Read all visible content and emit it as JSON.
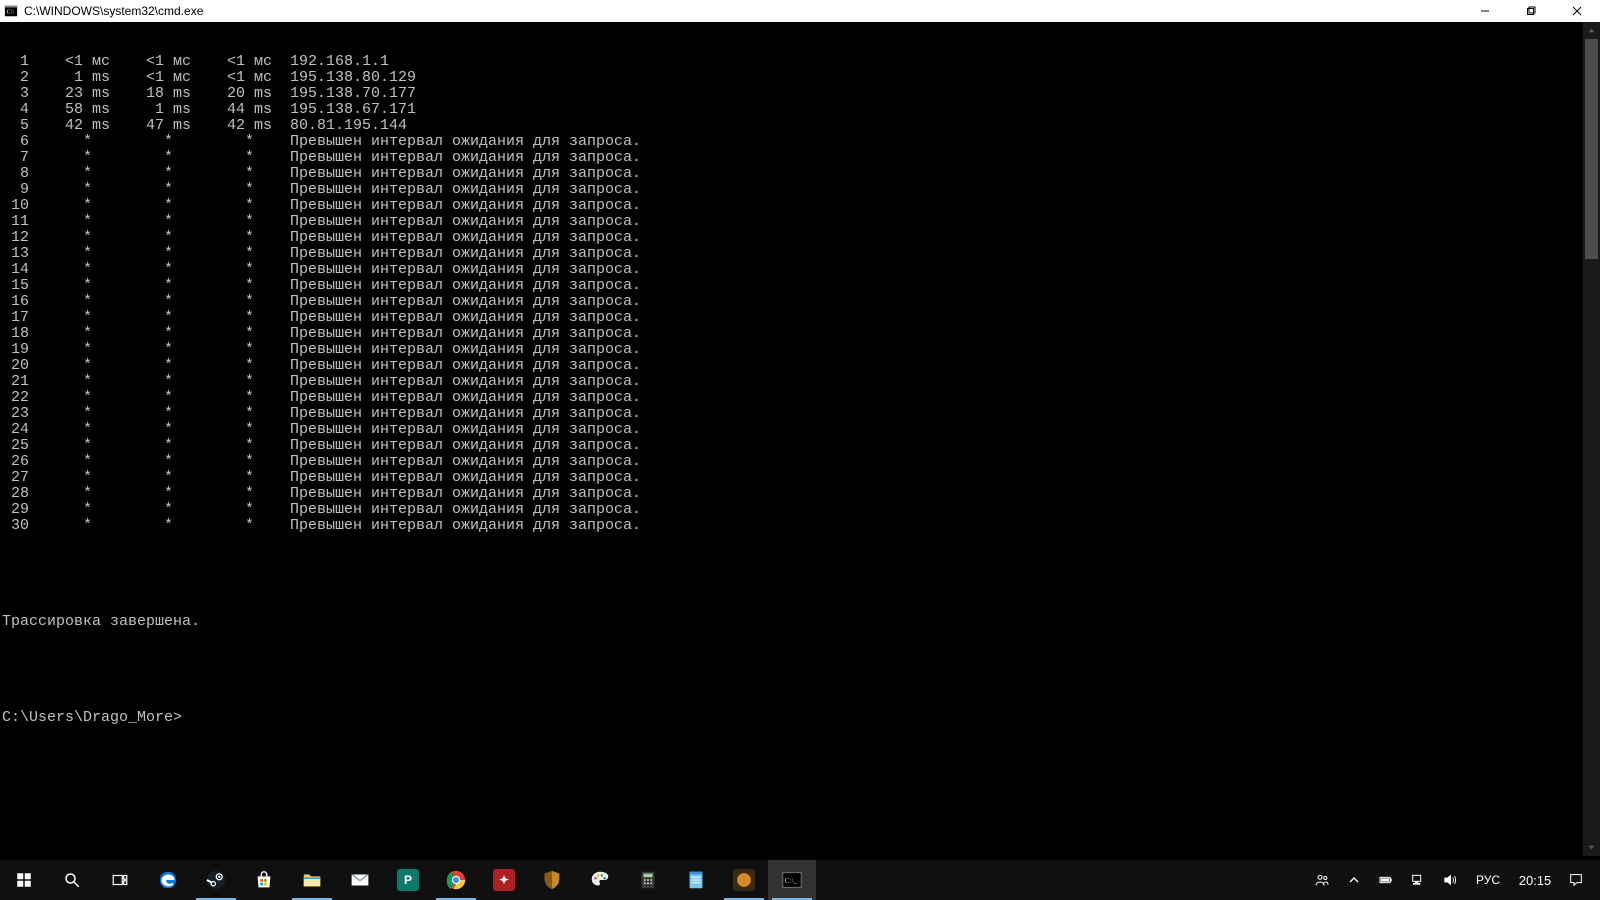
{
  "window": {
    "title": "C:\\WINDOWS\\system32\\cmd.exe"
  },
  "tracert": {
    "hops": [
      {
        "n": "1",
        "t1": "<1 мс",
        "t2": "<1 мс",
        "t3": "<1 мс",
        "host": "192.168.1.1"
      },
      {
        "n": "2",
        "t1": "1 ms",
        "t2": "<1 мс",
        "t3": "<1 мс",
        "host": "195.138.80.129"
      },
      {
        "n": "3",
        "t1": "23 ms",
        "t2": "18 ms",
        "t3": "20 ms",
        "host": "195.138.70.177"
      },
      {
        "n": "4",
        "t1": "58 ms",
        "t2": "1 ms",
        "t3": "44 ms",
        "host": "195.138.67.171"
      },
      {
        "n": "5",
        "t1": "42 ms",
        "t2": "47 ms",
        "t3": "42 ms",
        "host": "80.81.195.144"
      },
      {
        "n": "6",
        "t1": "*",
        "t2": "*",
        "t3": "*",
        "host": "Превышен интервал ожидания для запроса."
      },
      {
        "n": "7",
        "t1": "*",
        "t2": "*",
        "t3": "*",
        "host": "Превышен интервал ожидания для запроса."
      },
      {
        "n": "8",
        "t1": "*",
        "t2": "*",
        "t3": "*",
        "host": "Превышен интервал ожидания для запроса."
      },
      {
        "n": "9",
        "t1": "*",
        "t2": "*",
        "t3": "*",
        "host": "Превышен интервал ожидания для запроса."
      },
      {
        "n": "10",
        "t1": "*",
        "t2": "*",
        "t3": "*",
        "host": "Превышен интервал ожидания для запроса."
      },
      {
        "n": "11",
        "t1": "*",
        "t2": "*",
        "t3": "*",
        "host": "Превышен интервал ожидания для запроса."
      },
      {
        "n": "12",
        "t1": "*",
        "t2": "*",
        "t3": "*",
        "host": "Превышен интервал ожидания для запроса."
      },
      {
        "n": "13",
        "t1": "*",
        "t2": "*",
        "t3": "*",
        "host": "Превышен интервал ожидания для запроса."
      },
      {
        "n": "14",
        "t1": "*",
        "t2": "*",
        "t3": "*",
        "host": "Превышен интервал ожидания для запроса."
      },
      {
        "n": "15",
        "t1": "*",
        "t2": "*",
        "t3": "*",
        "host": "Превышен интервал ожидания для запроса."
      },
      {
        "n": "16",
        "t1": "*",
        "t2": "*",
        "t3": "*",
        "host": "Превышен интервал ожидания для запроса."
      },
      {
        "n": "17",
        "t1": "*",
        "t2": "*",
        "t3": "*",
        "host": "Превышен интервал ожидания для запроса."
      },
      {
        "n": "18",
        "t1": "*",
        "t2": "*",
        "t3": "*",
        "host": "Превышен интервал ожидания для запроса."
      },
      {
        "n": "19",
        "t1": "*",
        "t2": "*",
        "t3": "*",
        "host": "Превышен интервал ожидания для запроса."
      },
      {
        "n": "20",
        "t1": "*",
        "t2": "*",
        "t3": "*",
        "host": "Превышен интервал ожидания для запроса."
      },
      {
        "n": "21",
        "t1": "*",
        "t2": "*",
        "t3": "*",
        "host": "Превышен интервал ожидания для запроса."
      },
      {
        "n": "22",
        "t1": "*",
        "t2": "*",
        "t3": "*",
        "host": "Превышен интервал ожидания для запроса."
      },
      {
        "n": "23",
        "t1": "*",
        "t2": "*",
        "t3": "*",
        "host": "Превышен интервал ожидания для запроса."
      },
      {
        "n": "24",
        "t1": "*",
        "t2": "*",
        "t3": "*",
        "host": "Превышен интервал ожидания для запроса."
      },
      {
        "n": "25",
        "t1": "*",
        "t2": "*",
        "t3": "*",
        "host": "Превышен интервал ожидания для запроса."
      },
      {
        "n": "26",
        "t1": "*",
        "t2": "*",
        "t3": "*",
        "host": "Превышен интервал ожидания для запроса."
      },
      {
        "n": "27",
        "t1": "*",
        "t2": "*",
        "t3": "*",
        "host": "Превышен интервал ожидания для запроса."
      },
      {
        "n": "28",
        "t1": "*",
        "t2": "*",
        "t3": "*",
        "host": "Превышен интервал ожидания для запроса."
      },
      {
        "n": "29",
        "t1": "*",
        "t2": "*",
        "t3": "*",
        "host": "Превышен интервал ожидания для запроса."
      },
      {
        "n": "30",
        "t1": "*",
        "t2": "*",
        "t3": "*",
        "host": "Превышен интервал ожидания для запроса."
      }
    ],
    "complete": "Трассировка завершена.",
    "prompt": "C:\\Users\\Drago_More>"
  },
  "taskbar": {
    "apps": [
      {
        "id": "start",
        "type": "system",
        "icon": "windows"
      },
      {
        "id": "search",
        "type": "system",
        "icon": "search"
      },
      {
        "id": "taskview",
        "type": "system",
        "icon": "taskview"
      },
      {
        "id": "edge",
        "type": "app",
        "icon": "edge",
        "running": false
      },
      {
        "id": "steam",
        "type": "app",
        "icon": "steam",
        "running": true
      },
      {
        "id": "store",
        "type": "app",
        "icon": "store",
        "running": false
      },
      {
        "id": "explorer",
        "type": "app",
        "icon": "explorer",
        "running": true
      },
      {
        "id": "mail",
        "type": "app",
        "icon": "mail",
        "running": false
      },
      {
        "id": "publisher",
        "type": "app",
        "icon": "publisher",
        "running": false
      },
      {
        "id": "chrome",
        "type": "app",
        "icon": "chrome",
        "running": true
      },
      {
        "id": "app-x",
        "type": "app",
        "icon": "app-red",
        "running": false
      },
      {
        "id": "app-shield",
        "type": "app",
        "icon": "shield",
        "running": false
      },
      {
        "id": "paint",
        "type": "app",
        "icon": "paint",
        "running": false
      },
      {
        "id": "calc",
        "type": "app",
        "icon": "calc",
        "running": false
      },
      {
        "id": "notes",
        "type": "app",
        "icon": "notes",
        "running": false
      },
      {
        "id": "app-orange",
        "type": "app",
        "icon": "orange",
        "running": true
      },
      {
        "id": "cmd",
        "type": "app",
        "icon": "cmd",
        "running": true,
        "active": true
      }
    ],
    "tray": {
      "people": "people",
      "lang": "РУС",
      "time": "20:15"
    }
  }
}
